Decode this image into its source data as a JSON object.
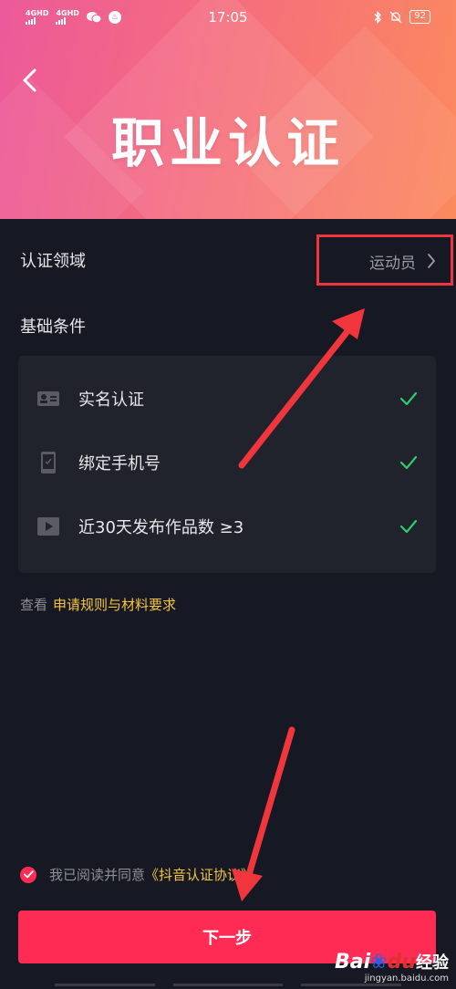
{
  "status_bar": {
    "sim1": "4GHD",
    "sim2": "4GHD",
    "time": "17:05",
    "battery": "92"
  },
  "header": {
    "title": "职业认证"
  },
  "field": {
    "label": "认证领域",
    "value": "运动员"
  },
  "conditions": {
    "title": "基础条件",
    "items": [
      {
        "label": "实名认证",
        "icon": "id-card-icon"
      },
      {
        "label": "绑定手机号",
        "icon": "phone-icon"
      },
      {
        "label": "近30天发布作品数 ≥3",
        "icon": "video-icon"
      }
    ]
  },
  "rules": {
    "prefix": "查看",
    "link": "申请规则与材料要求"
  },
  "agreement": {
    "text": "我已阅读并同意",
    "link": "《抖音认证协议》"
  },
  "next_button": {
    "label": "下一步"
  },
  "watermark": {
    "logo_bai": "Bai",
    "logo_du": "du",
    "logo_jy": "经验",
    "url": "jingyan.baidu.com"
  },
  "colors": {
    "accent": "#fe2c55",
    "link": "#f5c542",
    "check": "#2ecc71",
    "annotation": "#f0363c"
  }
}
